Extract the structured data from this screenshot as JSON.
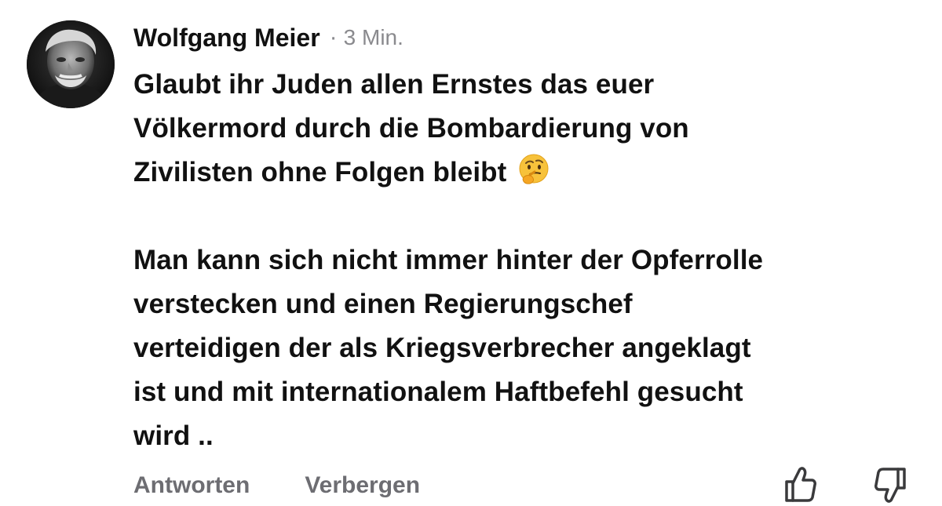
{
  "comment": {
    "author": "Wolfgang Meier",
    "separator": "·",
    "timestamp": "3 Min.",
    "paragraph1": [
      "Glaubt ihr Juden allen Ernstes das euer",
      "Völkermord durch die Bombardierung von",
      "Zivilisten ohne Folgen bleibt"
    ],
    "paragraph1_emoji": "thinking-face",
    "paragraph2": [
      "Man kann sich nicht immer hinter der Opferrolle",
      "verstecken und einen Regierungschef",
      "verteidigen der als Kriegsverbrecher angeklagt",
      "ist und mit internationalem Haftbefehl gesucht",
      "wird .."
    ]
  },
  "actions": {
    "reply_label": "Antworten",
    "hide_label": "Verbergen",
    "like_icon": "thumbs-up-icon",
    "dislike_icon": "thumbs-down-icon"
  },
  "colors": {
    "text": "#111111",
    "muted": "#6d6d72",
    "meta": "#8a8a8e",
    "background": "#ffffff"
  }
}
